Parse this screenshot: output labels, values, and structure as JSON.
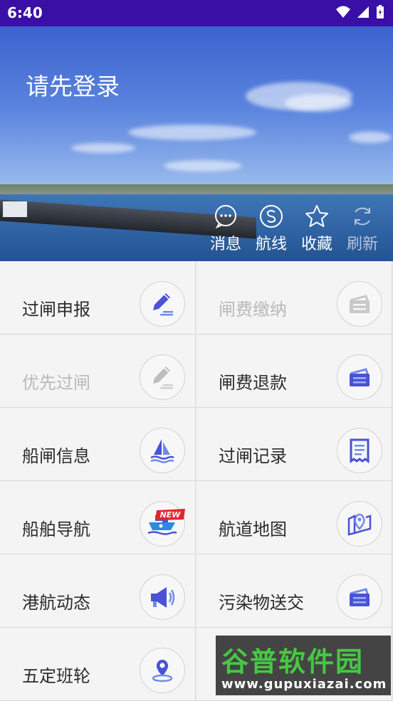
{
  "status_bar": {
    "time": "6:40"
  },
  "header": {
    "login_prompt": "请先登录",
    "actions": [
      {
        "label": "消息",
        "icon": "message-icon"
      },
      {
        "label": "航线",
        "icon": "route-icon"
      },
      {
        "label": "收藏",
        "icon": "star-icon"
      },
      {
        "label": "刷新",
        "icon": "refresh-icon"
      }
    ]
  },
  "menu": [
    {
      "label": "过闸申报",
      "icon": "pencil-edit-icon",
      "enabled": true
    },
    {
      "label": "闸费缴纳",
      "icon": "ticket-icon",
      "enabled": false
    },
    {
      "label": "优先过闸",
      "icon": "pencil-edit-icon",
      "enabled": false
    },
    {
      "label": "闸费退款",
      "icon": "ticket-icon",
      "enabled": true
    },
    {
      "label": "船闸信息",
      "icon": "sailboat-icon",
      "enabled": true
    },
    {
      "label": "过闸记录",
      "icon": "receipt-icon",
      "enabled": true
    },
    {
      "label": "船舶导航",
      "icon": "ship-navigation-icon",
      "enabled": true,
      "badge": "NEW"
    },
    {
      "label": "航道地图",
      "icon": "map-pin-icon",
      "enabled": true
    },
    {
      "label": "港航动态",
      "icon": "megaphone-icon",
      "enabled": true
    },
    {
      "label": "污染物送交",
      "icon": "ticket-icon",
      "enabled": true
    },
    {
      "label": "五定班轮",
      "icon": "location-icon",
      "enabled": true
    }
  ],
  "watermark": {
    "title": "谷普软件园",
    "url": "www.gupuxiazai.com"
  },
  "colors": {
    "status_bar": "#3a0fa6",
    "accent": "#4a52d6",
    "disabled": "#b9b9b9"
  }
}
